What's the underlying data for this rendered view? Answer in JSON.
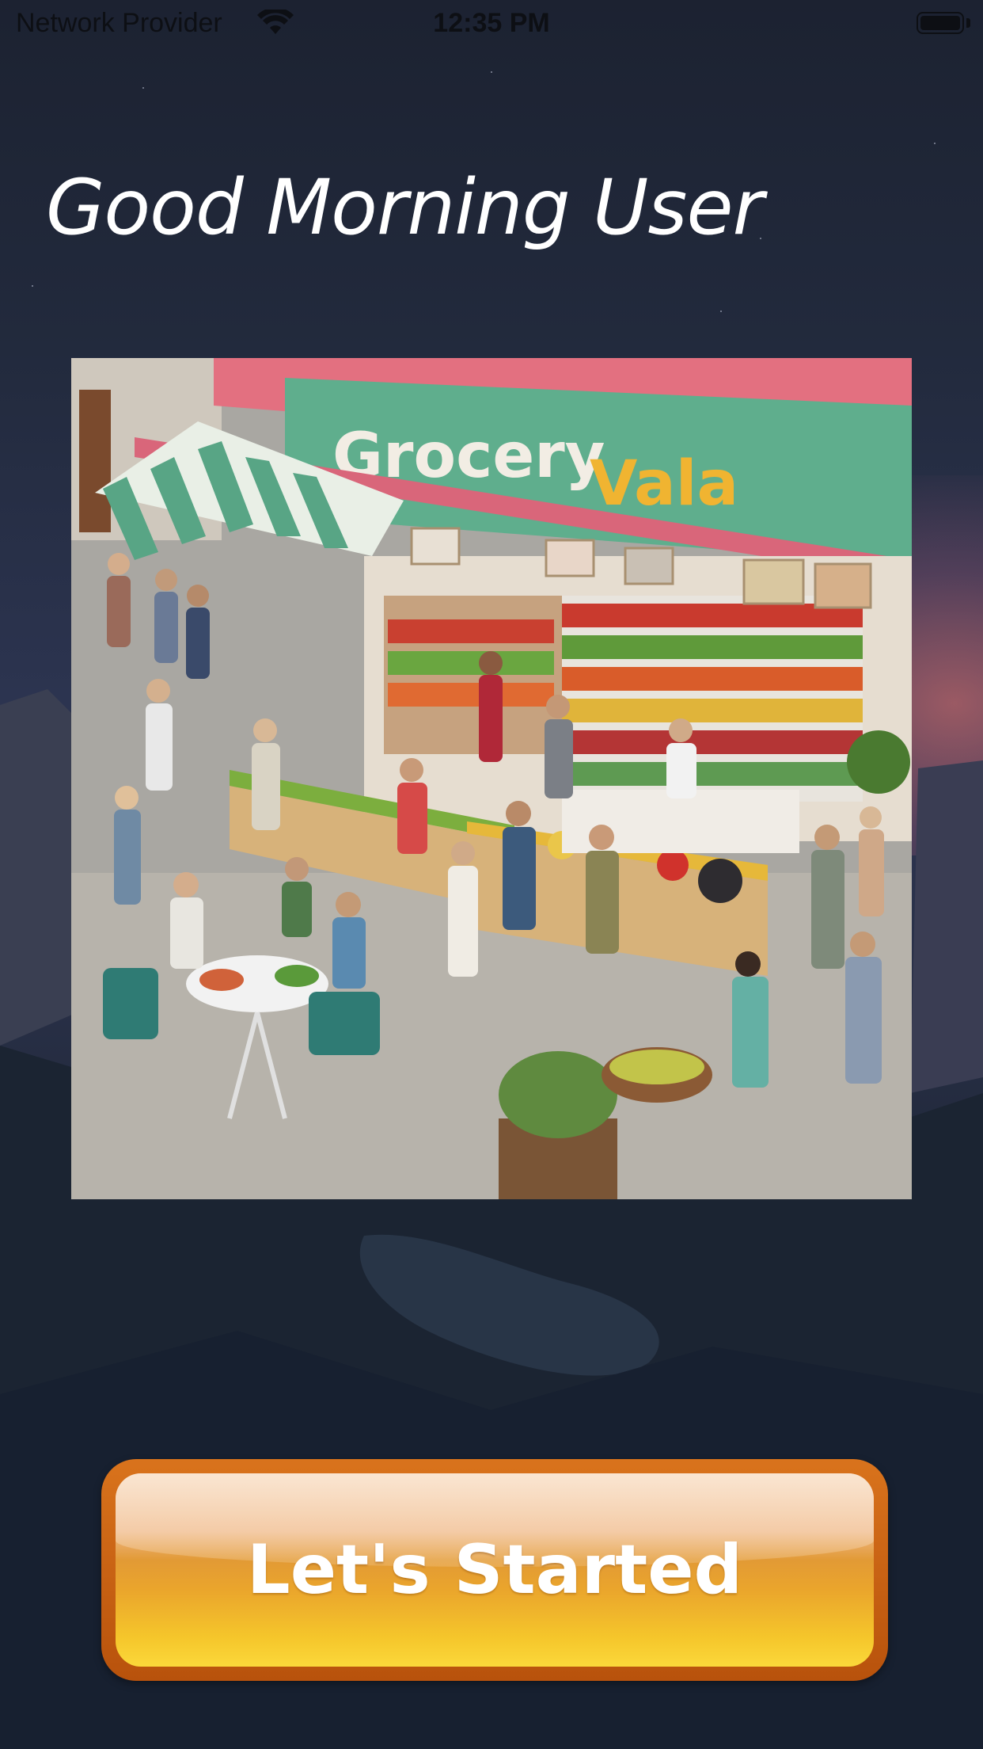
{
  "status_bar": {
    "carrier": "Network Provider",
    "time": "12:35 PM",
    "wifi_icon": "wifi-icon",
    "battery_icon": "battery-icon"
  },
  "greeting": "Good Morning User",
  "hero": {
    "store_name_part1": "Grocery",
    "store_name_part2": "Vala"
  },
  "cta": {
    "label": "Let's Started"
  },
  "colors": {
    "button_orange": "#d9731c",
    "button_yellow": "#f5c62b",
    "sign_green": "#5aa685",
    "sign_pink": "#e06878"
  }
}
